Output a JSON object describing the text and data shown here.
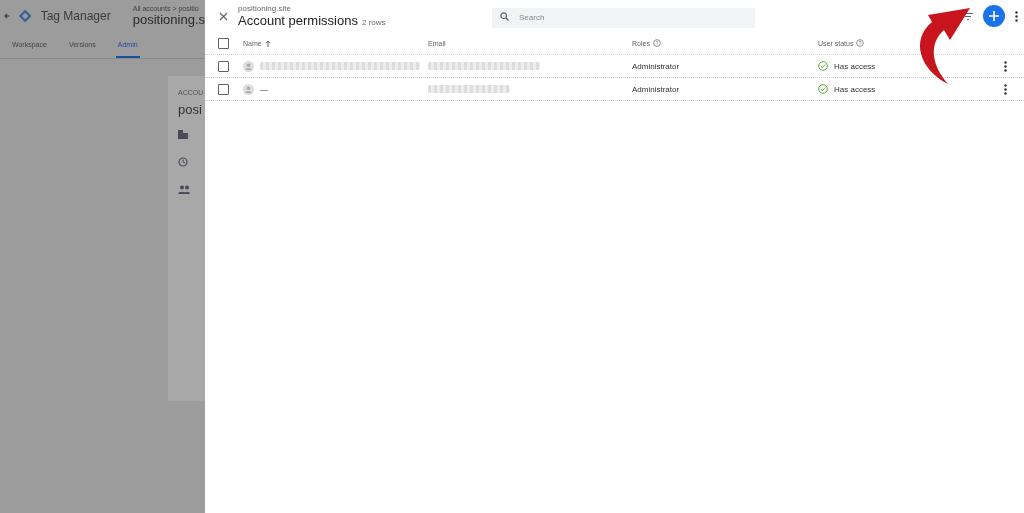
{
  "app": {
    "title": "Tag Manager",
    "breadcrumb": "All accounts > positio",
    "container": "positioning.s"
  },
  "tabs": [
    {
      "label": "Workspace",
      "selected": false
    },
    {
      "label": "Versions",
      "selected": false
    },
    {
      "label": "Admin",
      "selected": true
    }
  ],
  "admin_card": {
    "heading": "ACCOU",
    "name": "posi"
  },
  "panel": {
    "subtitle": "positioning.site",
    "title": "Account permissions",
    "count": "2 rows",
    "search": {
      "placeholder": "Search"
    }
  },
  "table": {
    "columns": [
      {
        "label": "Name",
        "sorted": true,
        "help": false
      },
      {
        "label": "Email",
        "sorted": false,
        "help": false
      },
      {
        "label": "Roles",
        "sorted": false,
        "help": true
      },
      {
        "label": "User status",
        "sorted": false,
        "help": true
      }
    ],
    "header_checked": false,
    "rows": [
      {
        "checked": false,
        "name_hidden": true,
        "email_hidden": true,
        "role": "Administrator",
        "status": "Has access"
      },
      {
        "checked": false,
        "name_hidden": false,
        "name": "—",
        "email_hidden": true,
        "role": "Administrator",
        "status": "Has access"
      }
    ]
  }
}
